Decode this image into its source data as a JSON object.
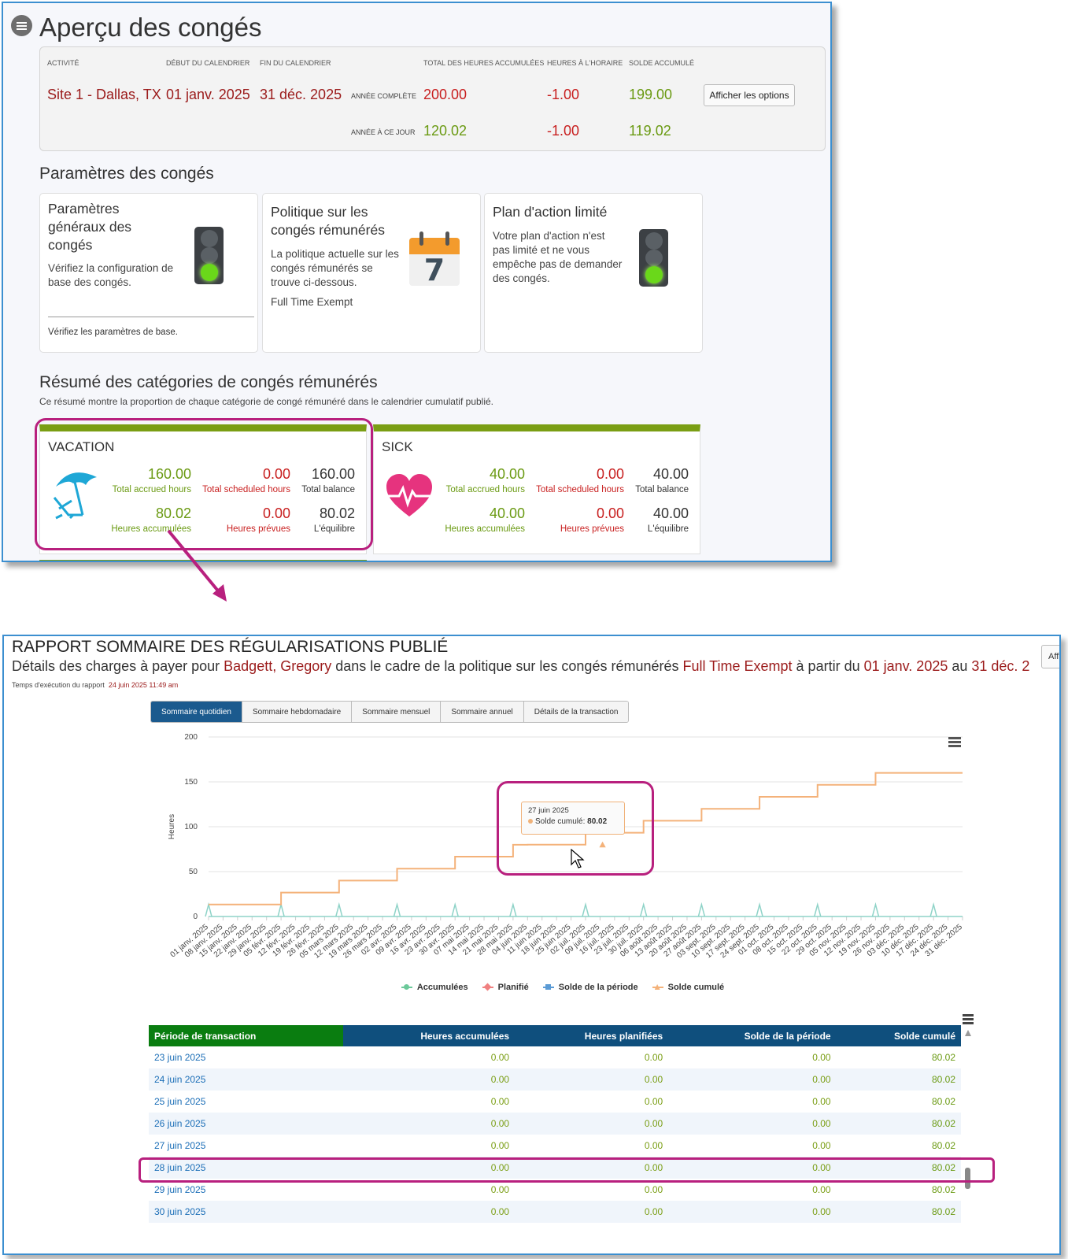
{
  "overview": {
    "title": "Aperçu des congés",
    "headers": {
      "activity": "ACTIVITÉ",
      "cal_start": "DÉBUT DU CALENDRIER",
      "cal_end": "FIN DU CALENDRIER",
      "total_accrued": "TOTAL DES HEURES ACCUMULÉES",
      "scheduled": "HEURES À L'HORAIRE",
      "balance": "SOLDE ACCUMULÉ"
    },
    "site": "Site 1 - Dallas, TX",
    "start": "01 janv. 2025",
    "end": "31 déc. 2025",
    "rows": [
      {
        "label": "ANNÉE COMPLÈTE",
        "accrued": "200.00",
        "scheduled": "-1.00",
        "balance": "199.00"
      },
      {
        "label": "ANNÉE À CE JOUR",
        "accrued": "120.02",
        "scheduled": "-1.00",
        "balance": "119.02"
      }
    ],
    "options_button": "Afficher les options"
  },
  "settings": {
    "title": "Paramètres des congés",
    "cards": [
      {
        "title": "Paramètres généraux des congés",
        "desc": "Vérifiez la configuration de base des congés.",
        "footer": "Vérifiez les paramètres de base."
      },
      {
        "title": "Politique sur les congés rémunérés",
        "desc": "La politique actuelle sur les congés rémunérés se trouve ci-dessous.",
        "policy": "Full Time Exempt",
        "calendar_day": "7"
      },
      {
        "title": "Plan d'action limité",
        "desc": "Votre plan d'action n'est pas limité et ne vous empêche pas de demander des congés."
      }
    ]
  },
  "categories": {
    "title": "Résumé des catégories de congés rémunérés",
    "subtitle": "Ce résumé montre la proportion de chaque catégorie de congé rémunéré dans le calendrier cumulatif publié.",
    "items": [
      {
        "name": "VACATION",
        "total_accrued": "160.00",
        "total_accrued_label": "Total accrued hours",
        "total_scheduled": "0.00",
        "total_scheduled_label": "Total scheduled hours",
        "total_balance": "160.00",
        "total_balance_label": "Total balance",
        "accrued": "80.02",
        "accrued_label": "Heures accumulées",
        "scheduled": "0.00",
        "scheduled_label": "Heures prévues",
        "balance": "80.02",
        "balance_label": "L'équilibre"
      },
      {
        "name": "SICK",
        "total_accrued": "40.00",
        "total_accrued_label": "Total accrued hours",
        "total_scheduled": "0.00",
        "total_scheduled_label": "Total scheduled hours",
        "total_balance": "40.00",
        "total_balance_label": "Total balance",
        "accrued": "40.00",
        "accrued_label": "Heures accumulées",
        "scheduled": "0.00",
        "scheduled_label": "Heures prévues",
        "balance": "40.00",
        "balance_label": "L'équilibre"
      }
    ]
  },
  "report": {
    "title": "RAPPORT SOMMAIRE DES RÉGULARISATIONS PUBLIÉ",
    "desc_prefix": "Détails des charges à payer pour ",
    "employee": "Badgett, Gregory",
    "desc_mid": " dans le cadre de la politique sur les congés rémunérés ",
    "policy": "Full Time Exempt",
    "desc_from": " à partir du ",
    "from": "01 janv. 2025",
    "desc_to": " au ",
    "to": "31 déc. 2",
    "exec_label": "Temps d'exécution du rapport",
    "exec_time": "24 juin 2025 11:49 am",
    "affi_button": "Affi",
    "tabs": [
      "Sommaire quotidien",
      "Sommaire hebdomadaire",
      "Sommaire mensuel",
      "Sommaire annuel",
      "Détails de la transaction"
    ],
    "tooltip": {
      "date": "27 juin 2025",
      "label": "Solde cumulé:",
      "value": "80.02"
    },
    "table": {
      "headers": [
        "Période de transaction",
        "Heures accumulées",
        "Heures planifiées",
        "Solde de la période",
        "Solde cumulé"
      ],
      "rows": [
        [
          "23 juin 2025",
          "0.00",
          "0.00",
          "0.00",
          "80.02"
        ],
        [
          "24 juin 2025",
          "0.00",
          "0.00",
          "0.00",
          "80.02"
        ],
        [
          "25 juin 2025",
          "0.00",
          "0.00",
          "0.00",
          "80.02"
        ],
        [
          "26 juin 2025",
          "0.00",
          "0.00",
          "0.00",
          "80.02"
        ],
        [
          "27 juin 2025",
          "0.00",
          "0.00",
          "0.00",
          "80.02"
        ],
        [
          "28 juin 2025",
          "0.00",
          "0.00",
          "0.00",
          "80.02"
        ],
        [
          "29 juin 2025",
          "0.00",
          "0.00",
          "0.00",
          "80.02"
        ],
        [
          "30 juin 2025",
          "0.00",
          "0.00",
          "0.00",
          "80.02"
        ]
      ]
    }
  },
  "chart_data": {
    "type": "line",
    "ylabel": "Heures",
    "ylim": [
      0,
      200
    ],
    "yticks": [
      0,
      50,
      100,
      150,
      200
    ],
    "grid": true,
    "legend_position": "bottom",
    "x": [
      "01 janv. 2025",
      "08 janv. 2025",
      "15 janv. 2025",
      "22 janv. 2025",
      "29 janv. 2025",
      "05 févr. 2025",
      "12 févr. 2025",
      "19 févr. 2025",
      "26 févr. 2025",
      "05 mars 2025",
      "12 mars 2025",
      "19 mars 2025",
      "26 mars 2025",
      "02 avr. 2025",
      "09 avr. 2025",
      "16 avr. 2025",
      "23 avr. 2025",
      "30 avr. 2025",
      "07 mai 2025",
      "14 mai 2025",
      "21 mai 2025",
      "28 mai 2025",
      "04 juin 2025",
      "11 juin 2025",
      "18 juin 2025",
      "25 juin 2025",
      "02 juil. 2025",
      "09 juil. 2025",
      "16 juil. 2025",
      "23 juil. 2025",
      "30 juil. 2025",
      "06 août 2025",
      "13 août 2025",
      "20 août 2025",
      "27 août 2025",
      "03 sept. 2025",
      "10 sept. 2025",
      "17 sept. 2025",
      "24 sept. 2025",
      "01 oct. 2025",
      "08 oct. 2025",
      "15 oct. 2025",
      "22 oct. 2025",
      "29 oct. 2025",
      "05 nov. 2025",
      "12 nov. 2025",
      "19 nov. 2025",
      "26 nov. 2025",
      "03 déc. 2025",
      "10 déc. 2025",
      "17 déc. 2025",
      "24 déc. 2025",
      "31 déc. 2025"
    ],
    "series": [
      {
        "name": "Accumulées",
        "color": "#8fd3c8",
        "values": [
          13.33,
          0,
          0,
          0,
          0,
          13.33,
          0,
          0,
          0,
          13.33,
          0,
          0,
          0,
          13.33,
          0,
          0,
          0,
          13.33,
          0,
          0,
          0,
          13.33,
          0,
          0,
          0,
          0,
          13.33,
          0,
          0,
          0,
          13.33,
          0,
          0,
          0,
          13.33,
          0,
          0,
          0,
          13.33,
          0,
          0,
          0,
          13.33,
          0,
          0,
          0,
          13.33,
          0,
          0,
          0,
          13.33,
          0,
          0
        ]
      },
      {
        "name": "Planifié",
        "color": "#f08080",
        "values": []
      },
      {
        "name": "Solde de la période",
        "color": "#5b9bd5",
        "values": []
      },
      {
        "name": "Solde cumulé",
        "color": "#f4b27a",
        "values": [
          13.33,
          13.33,
          13.33,
          13.33,
          13.33,
          26.66,
          26.66,
          26.66,
          26.66,
          39.99,
          39.99,
          39.99,
          39.99,
          53.32,
          53.32,
          53.32,
          53.32,
          66.65,
          66.65,
          66.65,
          66.65,
          79.98,
          80.02,
          80.02,
          80.02,
          80.02,
          93.35,
          93.35,
          93.35,
          93.35,
          106.68,
          106.68,
          106.68,
          106.68,
          120.01,
          120.01,
          120.01,
          120.01,
          133.34,
          133.34,
          133.34,
          133.34,
          146.67,
          146.67,
          146.67,
          146.67,
          160,
          160,
          160,
          160,
          160,
          160,
          160
        ]
      }
    ]
  }
}
